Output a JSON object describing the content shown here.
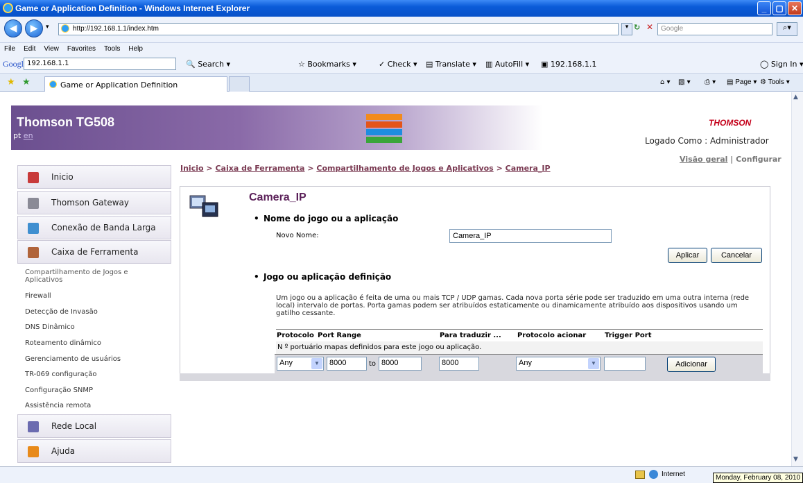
{
  "window": {
    "title": "Game or Application Definition - Windows Internet Explorer"
  },
  "address": {
    "url": "http://192.168.1.1/index.htm",
    "search_placeholder": "Google"
  },
  "menu": [
    "File",
    "Edit",
    "View",
    "Favorites",
    "Tools",
    "Help"
  ],
  "google_toolbar": {
    "brand": "Google",
    "query": "192.168.1.1",
    "items": [
      "Search",
      "Bookmarks",
      "Check",
      "Translate",
      "AutoFill",
      "192.168.1.1"
    ],
    "sign_in": "Sign In"
  },
  "tabs": {
    "active": "Game or Application Definition",
    "commands": [
      "Page",
      "Tools"
    ]
  },
  "header": {
    "title": "Thomson TG508",
    "lang_current": "pt",
    "lang_other": "en",
    "logo": "THOMSON",
    "logged_in": "Logado Como : Administrador"
  },
  "view_links": {
    "overview": "Visão geral",
    "separator": "|",
    "configure": "Configurar"
  },
  "breadcrumb": [
    "Inicio",
    "Caixa de Ferramenta",
    "Compartilhamento de Jogos e Aplicativos",
    "Camera_IP"
  ],
  "breadcrumb_sep": ">",
  "sidebar": {
    "top": [
      "Inicio",
      "Thomson Gateway",
      "Conexão de Banda Larga",
      "Caixa de Ferramenta"
    ],
    "sub": [
      "Compartilhamento de Jogos e Aplicativos",
      "Firewall",
      "Detecção de Invasão",
      "DNS Dinâmico",
      "Roteamento dinâmico",
      "Gerenciamento de usuários",
      "TR-069 configuração",
      "Configuração SNMP",
      "Assistência remota"
    ],
    "bottom": [
      "Rede Local",
      "Ajuda"
    ]
  },
  "main": {
    "title": "Camera_IP",
    "section1": "Nome do jogo ou a aplicação",
    "new_name_label": "Novo Nome:",
    "new_name_value": "Camera_IP",
    "apply": "Aplicar",
    "cancel": "Cancelar",
    "section2": "Jogo ou aplicação definição",
    "description": "Um jogo ou a aplicação é feita de uma ou mais TCP / UDP gamas. Cada nova porta série pode ser traduzido em uma outra interna (rede local) intervalo de portas. Porta gamas podem ser atribuídos estaticamente ou dinamicamente atribuído aos dispositivos usando um gatilho cessante.",
    "table": {
      "headers": [
        "Protocolo",
        "Port Range",
        "Para traduzir ...",
        "Protocolo acionar",
        "Trigger Port"
      ],
      "empty_message": "N º portuário mapas definidos para este jogo ou aplicação.",
      "input_row": {
        "protocol": "Any",
        "from": "8000",
        "to_label": "to",
        "to": "8000",
        "translate": "8000",
        "trigger_protocol": "Any",
        "trigger_port": "",
        "add": "Adicionar"
      }
    }
  },
  "status": {
    "zone": "Internet",
    "tooltip": "Monday, February 08, 2010"
  }
}
